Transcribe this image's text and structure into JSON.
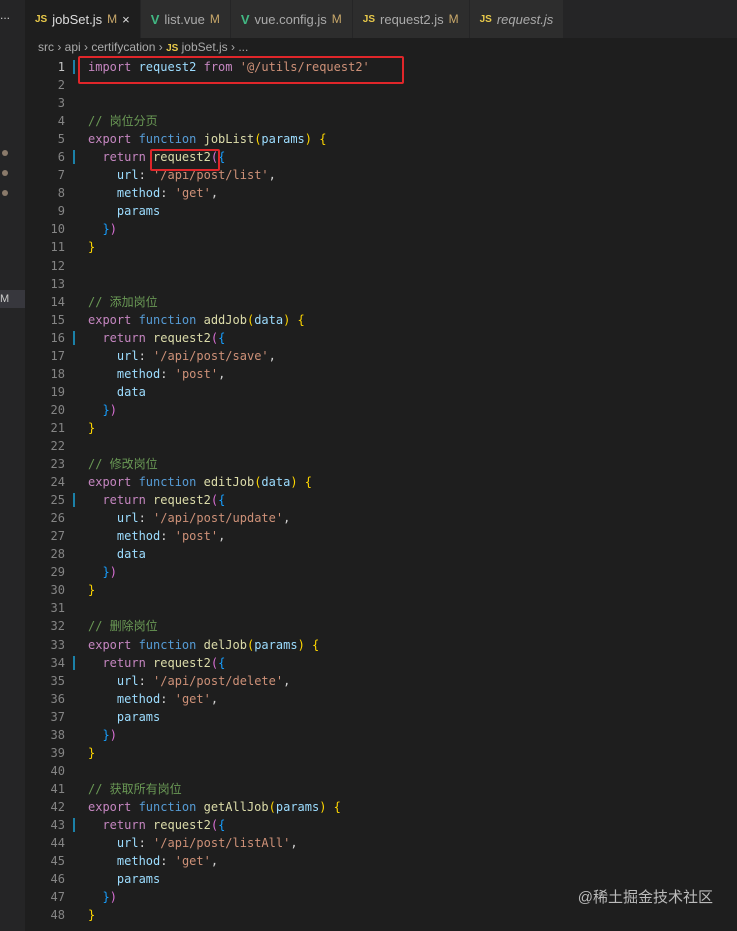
{
  "sidebar": {
    "more": "...",
    "badge": "M"
  },
  "tabs": [
    {
      "icon": "JS",
      "label": "jobSet.js",
      "mod": "M",
      "close": "×",
      "active": true
    },
    {
      "icon": "V",
      "label": "list.vue",
      "mod": "M"
    },
    {
      "icon": "V",
      "label": "vue.config.js",
      "mod": "M"
    },
    {
      "icon": "JS",
      "label": "request2.js",
      "mod": "M"
    },
    {
      "icon": "JS",
      "label": "request.js",
      "mod": "",
      "italic": true
    }
  ],
  "breadcrumb": [
    "src",
    "api",
    "certifycation",
    "jobSet.js",
    "..."
  ],
  "breadcrumb_js": "JS",
  "code": [
    [
      [
        "kw",
        "import "
      ],
      [
        "vr",
        "request2 "
      ],
      [
        "kw",
        "from "
      ],
      [
        "st",
        "'@/utils/request2'"
      ]
    ],
    [],
    [],
    [
      [
        "cm",
        "// 岗位分页"
      ]
    ],
    [
      [
        "kw",
        "export "
      ],
      [
        "fn",
        "function "
      ],
      [
        "nm",
        "jobList"
      ],
      [
        "b1",
        "("
      ],
      [
        "vr",
        "params"
      ],
      [
        "b1",
        ") {"
      ]
    ],
    [
      [
        "pl",
        "  "
      ],
      [
        "kw",
        "return "
      ],
      [
        "nm",
        "request2"
      ],
      [
        "b2",
        "("
      ],
      [
        "b3",
        "{"
      ]
    ],
    [
      [
        "pl",
        "    "
      ],
      [
        "vr",
        "url"
      ],
      [
        "pl",
        ": "
      ],
      [
        "st",
        "'/api/post/list'"
      ],
      [
        "pl",
        ","
      ]
    ],
    [
      [
        "pl",
        "    "
      ],
      [
        "vr",
        "method"
      ],
      [
        "pl",
        ": "
      ],
      [
        "st",
        "'get'"
      ],
      [
        "pl",
        ","
      ]
    ],
    [
      [
        "pl",
        "    "
      ],
      [
        "vr",
        "params"
      ]
    ],
    [
      [
        "pl",
        "  "
      ],
      [
        "b3",
        "}"
      ],
      [
        "b2",
        ")"
      ]
    ],
    [
      [
        "b1",
        "}"
      ]
    ],
    [],
    [],
    [
      [
        "cm",
        "// 添加岗位"
      ]
    ],
    [
      [
        "kw",
        "export "
      ],
      [
        "fn",
        "function "
      ],
      [
        "nm",
        "addJob"
      ],
      [
        "b1",
        "("
      ],
      [
        "vr",
        "data"
      ],
      [
        "b1",
        ") {"
      ]
    ],
    [
      [
        "pl",
        "  "
      ],
      [
        "kw",
        "return "
      ],
      [
        "nm",
        "request2"
      ],
      [
        "b2",
        "("
      ],
      [
        "b3",
        "{"
      ]
    ],
    [
      [
        "pl",
        "    "
      ],
      [
        "vr",
        "url"
      ],
      [
        "pl",
        ": "
      ],
      [
        "st",
        "'/api/post/save'"
      ],
      [
        "pl",
        ","
      ]
    ],
    [
      [
        "pl",
        "    "
      ],
      [
        "vr",
        "method"
      ],
      [
        "pl",
        ": "
      ],
      [
        "st",
        "'post'"
      ],
      [
        "pl",
        ","
      ]
    ],
    [
      [
        "pl",
        "    "
      ],
      [
        "vr",
        "data"
      ]
    ],
    [
      [
        "pl",
        "  "
      ],
      [
        "b3",
        "}"
      ],
      [
        "b2",
        ")"
      ]
    ],
    [
      [
        "b1",
        "}"
      ]
    ],
    [],
    [
      [
        "cm",
        "// 修改岗位"
      ]
    ],
    [
      [
        "kw",
        "export "
      ],
      [
        "fn",
        "function "
      ],
      [
        "nm",
        "editJob"
      ],
      [
        "b1",
        "("
      ],
      [
        "vr",
        "data"
      ],
      [
        "b1",
        ") {"
      ]
    ],
    [
      [
        "pl",
        "  "
      ],
      [
        "kw",
        "return "
      ],
      [
        "nm",
        "request2"
      ],
      [
        "b2",
        "("
      ],
      [
        "b3",
        "{"
      ]
    ],
    [
      [
        "pl",
        "    "
      ],
      [
        "vr",
        "url"
      ],
      [
        "pl",
        ": "
      ],
      [
        "st",
        "'/api/post/update'"
      ],
      [
        "pl",
        ","
      ]
    ],
    [
      [
        "pl",
        "    "
      ],
      [
        "vr",
        "method"
      ],
      [
        "pl",
        ": "
      ],
      [
        "st",
        "'post'"
      ],
      [
        "pl",
        ","
      ]
    ],
    [
      [
        "pl",
        "    "
      ],
      [
        "vr",
        "data"
      ]
    ],
    [
      [
        "pl",
        "  "
      ],
      [
        "b3",
        "}"
      ],
      [
        "b2",
        ")"
      ]
    ],
    [
      [
        "b1",
        "}"
      ]
    ],
    [],
    [
      [
        "cm",
        "// 删除岗位"
      ]
    ],
    [
      [
        "kw",
        "export "
      ],
      [
        "fn",
        "function "
      ],
      [
        "nm",
        "delJob"
      ],
      [
        "b1",
        "("
      ],
      [
        "vr",
        "params"
      ],
      [
        "b1",
        ") {"
      ]
    ],
    [
      [
        "pl",
        "  "
      ],
      [
        "kw",
        "return "
      ],
      [
        "nm",
        "request2"
      ],
      [
        "b2",
        "("
      ],
      [
        "b3",
        "{"
      ]
    ],
    [
      [
        "pl",
        "    "
      ],
      [
        "vr",
        "url"
      ],
      [
        "pl",
        ": "
      ],
      [
        "st",
        "'/api/post/delete'"
      ],
      [
        "pl",
        ","
      ]
    ],
    [
      [
        "pl",
        "    "
      ],
      [
        "vr",
        "method"
      ],
      [
        "pl",
        ": "
      ],
      [
        "st",
        "'get'"
      ],
      [
        "pl",
        ","
      ]
    ],
    [
      [
        "pl",
        "    "
      ],
      [
        "vr",
        "params"
      ]
    ],
    [
      [
        "pl",
        "  "
      ],
      [
        "b3",
        "}"
      ],
      [
        "b2",
        ")"
      ]
    ],
    [
      [
        "b1",
        "}"
      ]
    ],
    [],
    [
      [
        "cm",
        "// 获取所有岗位"
      ]
    ],
    [
      [
        "kw",
        "export "
      ],
      [
        "fn",
        "function "
      ],
      [
        "nm",
        "getAllJob"
      ],
      [
        "b1",
        "("
      ],
      [
        "vr",
        "params"
      ],
      [
        "b1",
        ") {"
      ]
    ],
    [
      [
        "pl",
        "  "
      ],
      [
        "kw",
        "return "
      ],
      [
        "nm",
        "request2"
      ],
      [
        "b2",
        "("
      ],
      [
        "b3",
        "{"
      ]
    ],
    [
      [
        "pl",
        "    "
      ],
      [
        "vr",
        "url"
      ],
      [
        "pl",
        ": "
      ],
      [
        "st",
        "'/api/post/listAll'"
      ],
      [
        "pl",
        ","
      ]
    ],
    [
      [
        "pl",
        "    "
      ],
      [
        "vr",
        "method"
      ],
      [
        "pl",
        ": "
      ],
      [
        "st",
        "'get'"
      ],
      [
        "pl",
        ","
      ]
    ],
    [
      [
        "pl",
        "    "
      ],
      [
        "vr",
        "params"
      ]
    ],
    [
      [
        "pl",
        "  "
      ],
      [
        "b3",
        "}"
      ],
      [
        "b2",
        ")"
      ]
    ],
    [
      [
        "b1",
        "}"
      ]
    ]
  ],
  "modified_lines": [
    1,
    6,
    16,
    25,
    34,
    43
  ],
  "current_line": 1,
  "watermark": "@稀土掘金技术社区"
}
